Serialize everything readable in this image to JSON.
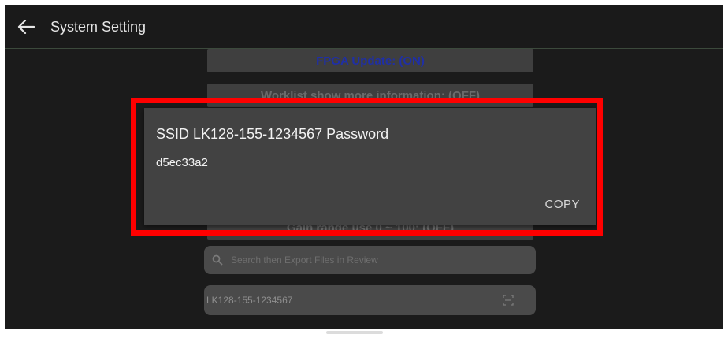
{
  "header": {
    "title": "System Setting",
    "back_icon": "arrow-left-icon"
  },
  "settings": {
    "fpga_update": "FPGA Update: (ON)",
    "worklist_info": "Worklist show more information: (OFF)",
    "gain_range": "Gain range use 0 ~ 100: (OFF)"
  },
  "search": {
    "placeholder": "Search then Export Files in Review",
    "icon": "search-icon"
  },
  "ssid_field": {
    "value": "LK128-155-1234567",
    "icon": "qr-scan-icon"
  },
  "dialog": {
    "title": "SSID LK128-155-1234567 Password",
    "message": "d5ec33a2",
    "copy_label": "COPY"
  },
  "colors": {
    "highlight": "#ff0000",
    "fpga_text": "#1f2fa6",
    "dialog_bg": "#424242"
  }
}
